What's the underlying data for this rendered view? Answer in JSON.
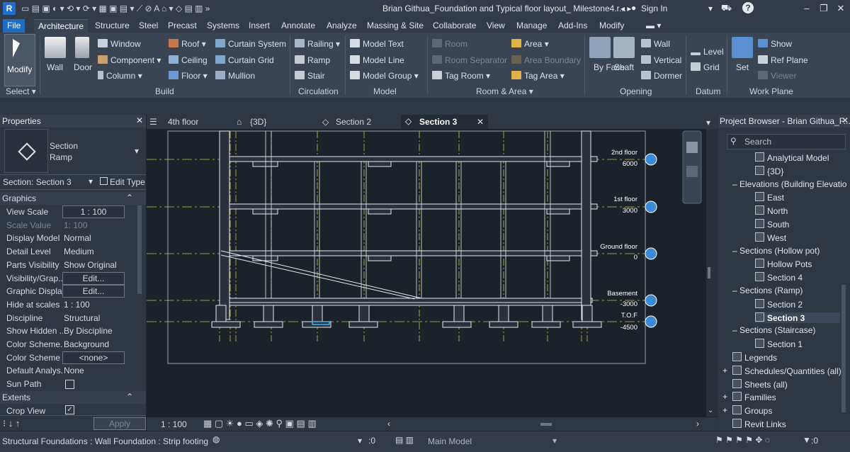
{
  "titlebar": {
    "logo": "R",
    "doc_title": "Brian Githua_Foundation and Typical floor layout_ Milestone4.r...",
    "signin": "Sign In",
    "window_buttons": [
      "–",
      "❐",
      "✕"
    ]
  },
  "tabs": [
    "File",
    "Architecture",
    "Structure",
    "Steel",
    "Precast",
    "Systems",
    "Insert",
    "Annotate",
    "Analyze",
    "Massing & Site",
    "Collaborate",
    "View",
    "Manage",
    "Add-Ins",
    "Modify"
  ],
  "active_tab": "Architecture",
  "ribbon": {
    "select": {
      "modify": "Modify",
      "group": "Select"
    },
    "build": {
      "group": "Build",
      "wall": "Wall",
      "door": "Door",
      "window": "Window",
      "component": "Component",
      "column": "Column",
      "roof": "Roof",
      "ceiling": "Ceiling",
      "floor": "Floor",
      "curtain_system": "Curtain System",
      "curtain_grid": "Curtain Grid",
      "mullion": "Mullion"
    },
    "circulation": {
      "group": "Circulation",
      "railing": "Railing",
      "ramp": "Ramp",
      "stair": "Stair"
    },
    "model": {
      "group": "Model",
      "model_text": "Model Text",
      "model_line": "Model Line",
      "model_group": "Model Group"
    },
    "room_area": {
      "group": "Room & Area",
      "room": "Room",
      "room_separator": "Room Separator",
      "tag_room": "Tag Room",
      "area": "Area",
      "area_boundary": "Area Boundary",
      "tag_area": "Tag Area"
    },
    "opening": {
      "group": "Opening",
      "by_face": "By Face",
      "shaft": "Shaft",
      "wall": "Wall",
      "vertical": "Vertical",
      "dormer": "Dormer"
    },
    "datum": {
      "group": "Datum",
      "level": "Level",
      "grid": "Grid"
    },
    "work_plane": {
      "group": "Work Plane",
      "set": "Set",
      "show": "Show",
      "ref_plane": "Ref Plane",
      "viewer": "Viewer"
    }
  },
  "properties": {
    "title": "Properties",
    "type_family": "Section",
    "type_name": "Ramp",
    "selector": "Section: Section 3",
    "edit_type": "Edit Type",
    "sections": {
      "graphics": "Graphics",
      "extents": "Extents"
    },
    "rows": [
      {
        "k": "View Scale",
        "v": "1 : 100",
        "box": true
      },
      {
        "k": "Scale Value",
        "v": "1:  100",
        "dim": true
      },
      {
        "k": "Display Model",
        "v": "Normal"
      },
      {
        "k": "Detail Level",
        "v": "Medium"
      },
      {
        "k": "Parts Visibility",
        "v": "Show Original"
      },
      {
        "k": "Visibility/Grap...",
        "v": "Edit...",
        "box": true
      },
      {
        "k": "Graphic Displa...",
        "v": "Edit...",
        "box": true
      },
      {
        "k": "Hide at scales ...",
        "v": "1 : 100"
      },
      {
        "k": "Discipline",
        "v": "Structural"
      },
      {
        "k": "Show Hidden ...",
        "v": "By Discipline"
      },
      {
        "k": "Color Scheme...",
        "v": "Background"
      },
      {
        "k": "Color Scheme",
        "v": "<none>",
        "box": true
      },
      {
        "k": "Default Analys...",
        "v": "None"
      },
      {
        "k": "Sun Path",
        "v": ""
      }
    ],
    "crop_view": "Crop View",
    "apply": "Apply"
  },
  "view_tabs": [
    {
      "label": "4th floor",
      "active": false
    },
    {
      "label": "{3D}",
      "active": false
    },
    {
      "label": "Section 2",
      "active": false
    },
    {
      "label": "Section 3",
      "active": true
    }
  ],
  "levels": [
    {
      "name": "2nd floor",
      "elev": "6000"
    },
    {
      "name": "1st floor",
      "elev": "3000"
    },
    {
      "name": "Ground floor",
      "elev": "0"
    },
    {
      "name": "Basement",
      "elev": "-3000"
    },
    {
      "name": "T.O.F",
      "elev": "-4500"
    }
  ],
  "view_control": {
    "scale": "1 : 100"
  },
  "project_browser": {
    "title": "Project Browser - Brian Githua_F...",
    "search_placeholder": "Search",
    "items": [
      {
        "label": "Analytical Model",
        "indent": 3,
        "leaf": true
      },
      {
        "label": "{3D}",
        "indent": 3,
        "leaf": true
      },
      {
        "label": "Elevations (Building Elevatio",
        "indent": 2,
        "leaf": false
      },
      {
        "label": "East",
        "indent": 3,
        "leaf": true
      },
      {
        "label": "North",
        "indent": 3,
        "leaf": true
      },
      {
        "label": "South",
        "indent": 3,
        "leaf": true
      },
      {
        "label": "West",
        "indent": 3,
        "leaf": true
      },
      {
        "label": "Sections (Hollow pot)",
        "indent": 2,
        "leaf": false
      },
      {
        "label": "Hollow Pots",
        "indent": 3,
        "leaf": true
      },
      {
        "label": "Section 4",
        "indent": 3,
        "leaf": true
      },
      {
        "label": "Sections (Ramp)",
        "indent": 2,
        "leaf": false
      },
      {
        "label": "Section 2",
        "indent": 3,
        "leaf": true
      },
      {
        "label": "Section 3",
        "indent": 3,
        "leaf": true,
        "selected": true
      },
      {
        "label": "Sections (Staircase)",
        "indent": 2,
        "leaf": false
      },
      {
        "label": "Section 1",
        "indent": 3,
        "leaf": true
      },
      {
        "label": "Legends",
        "indent": 1,
        "leaf": true
      },
      {
        "label": "Schedules/Quantities (all)",
        "indent": 1,
        "leaf": true,
        "plus": true
      },
      {
        "label": "Sheets (all)",
        "indent": 1,
        "leaf": true
      },
      {
        "label": "Families",
        "indent": 1,
        "leaf": true,
        "plus": true
      },
      {
        "label": "Groups",
        "indent": 1,
        "leaf": true,
        "plus": true
      },
      {
        "label": "Revit Links",
        "indent": 1,
        "leaf": true
      }
    ]
  },
  "status": {
    "message": "Structural Foundations : Wall Foundation : Strip footing 90(",
    "selection_count": ":0",
    "workset": "Main Model",
    "filter_count": ":0"
  }
}
